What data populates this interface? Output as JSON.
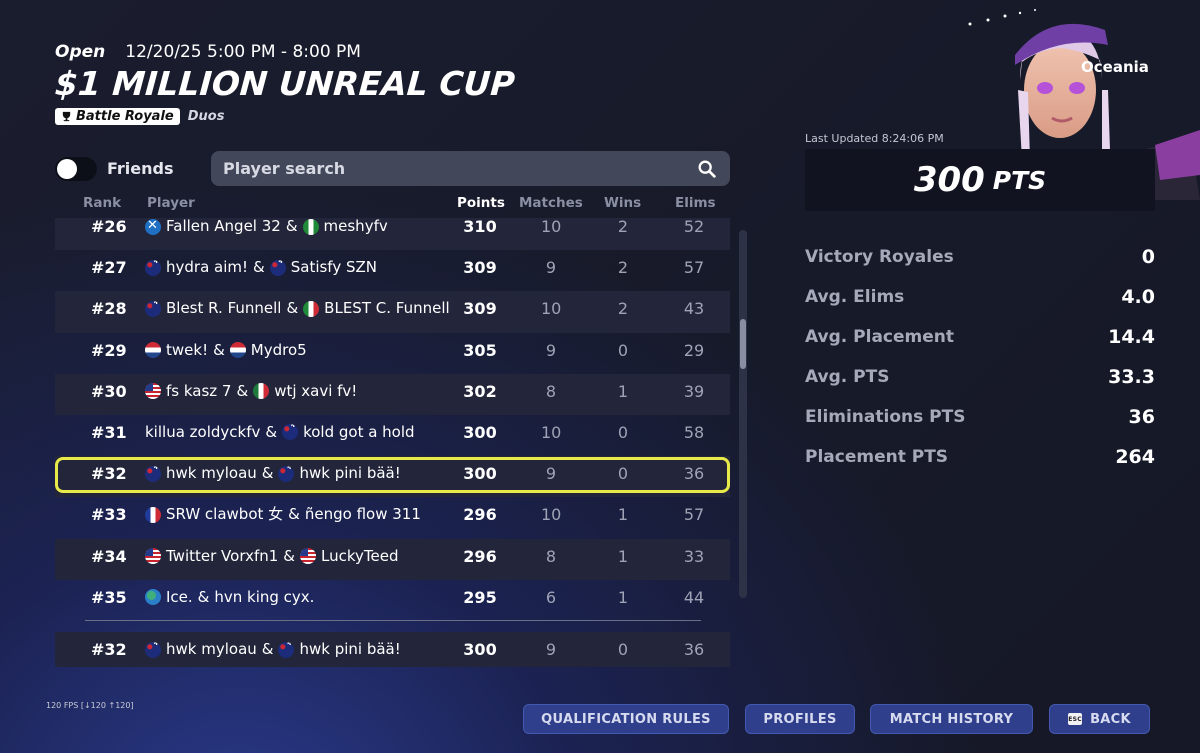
{
  "header": {
    "status": "Open",
    "datetime": "12/20/25 5:00 PM - 8:00 PM",
    "title": "$1 MILLION UNREAL CUP",
    "mode": "Battle Royale",
    "team_size": "Duos"
  },
  "controls": {
    "friends_label": "Friends",
    "friends_toggle_on": false,
    "search_placeholder": "Player search"
  },
  "columns": {
    "rank": "Rank",
    "player": "Player",
    "points": "Points",
    "matches": "Matches",
    "wins": "Wins",
    "elims": "Elims"
  },
  "rows": [
    {
      "rank": "#26",
      "p1_flag": "sc",
      "p1": "Fallen Angel 32",
      "p2_flag": "ng",
      "p2": "meshyfv",
      "points": "310",
      "matches": "10",
      "wins": "2",
      "elims": "52"
    },
    {
      "rank": "#27",
      "p1_flag": "au",
      "p1": "hydra aim!",
      "p2_flag": "au",
      "p2": "Satisfy SZN",
      "points": "309",
      "matches": "9",
      "wins": "2",
      "elims": "57"
    },
    {
      "rank": "#28",
      "p1_flag": "au",
      "p1": "Blest R. Funnell",
      "p2_flag": "it",
      "p2": "BLEST C. Funnell",
      "points": "309",
      "matches": "10",
      "wins": "2",
      "elims": "43"
    },
    {
      "rank": "#29",
      "p1_flag": "nl",
      "p1": "twek!",
      "p2_flag": "nl",
      "p2": "Mydro5",
      "points": "305",
      "matches": "9",
      "wins": "0",
      "elims": "29"
    },
    {
      "rank": "#30",
      "p1_flag": "us",
      "p1": "fs kasz 7",
      "p2_flag": "mx",
      "p2": "wtj xavi fv!",
      "points": "302",
      "matches": "8",
      "wins": "1",
      "elims": "39"
    },
    {
      "rank": "#31",
      "p1_flag": "",
      "p1": "killua zoldyckfv",
      "p2_flag": "au",
      "p2": "kold got a hold",
      "points": "300",
      "matches": "10",
      "wins": "0",
      "elims": "58"
    },
    {
      "rank": "#32",
      "p1_flag": "au",
      "p1": "hwk myloau",
      "p2_flag": "au",
      "p2": "hwk pini bää!",
      "points": "300",
      "matches": "9",
      "wins": "0",
      "elims": "36"
    },
    {
      "rank": "#33",
      "p1_flag": "fr",
      "p1": "SRW clawbot 女",
      "p2_flag": "",
      "p2": "ñengo flow 311",
      "points": "296",
      "matches": "10",
      "wins": "1",
      "elims": "57"
    },
    {
      "rank": "#34",
      "p1_flag": "us",
      "p1": "Twitter Vorxfn1",
      "p2_flag": "us",
      "p2": "LuckyTeed",
      "points": "296",
      "matches": "8",
      "wins": "1",
      "elims": "33"
    },
    {
      "rank": "#35",
      "p1_flag": "globe",
      "p1": "Ice.",
      "p2_flag": "",
      "p2": "hvn king cyx.",
      "points": "295",
      "matches": "6",
      "wins": "1",
      "elims": "44"
    }
  ],
  "my_row": {
    "rank": "#32",
    "p1": "hwk myloau",
    "p2": "hwk pini bää!",
    "points": "300",
    "matches": "9",
    "wins": "0",
    "elims": "36"
  },
  "amp": "&",
  "region": "Oceania",
  "last_updated": "Last Updated 8:24:06 PM",
  "total_points": "300",
  "total_points_unit": "PTS",
  "stats": [
    {
      "label": "Victory Royales",
      "value": "0"
    },
    {
      "label": "Avg. Elims",
      "value": "4.0"
    },
    {
      "label": "Avg. Placement",
      "value": "14.4"
    },
    {
      "label": "Avg. PTS",
      "value": "33.3"
    },
    {
      "label": "Eliminations PTS",
      "value": "36"
    },
    {
      "label": "Placement PTS",
      "value": "264"
    }
  ],
  "fps": "120 FPS [↓120 ↑120]",
  "buttons": {
    "qualification_rules": "QUALIFICATION RULES",
    "profiles": "PROFILES",
    "match_history": "MATCH HISTORY",
    "esc_key": "ESC",
    "back": "BACK"
  },
  "colors": {
    "highlight": "#e8ea4a",
    "button_bg": "#2f3f8c",
    "row_alt": "#23263a"
  }
}
